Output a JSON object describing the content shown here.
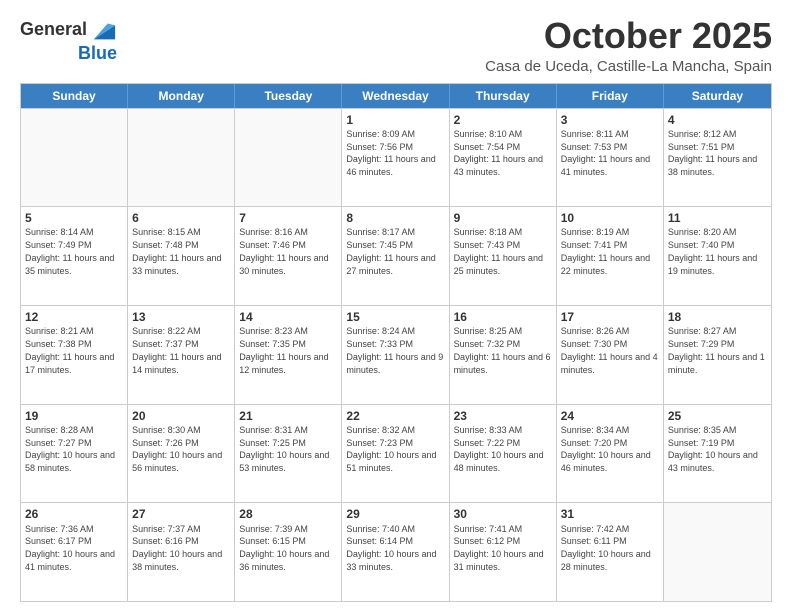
{
  "header": {
    "logo_general": "General",
    "logo_blue": "Blue",
    "month": "October 2025",
    "location": "Casa de Uceda, Castille-La Mancha, Spain"
  },
  "days_of_week": [
    "Sunday",
    "Monday",
    "Tuesday",
    "Wednesday",
    "Thursday",
    "Friday",
    "Saturday"
  ],
  "weeks": [
    [
      {
        "day": "",
        "info": ""
      },
      {
        "day": "",
        "info": ""
      },
      {
        "day": "",
        "info": ""
      },
      {
        "day": "1",
        "info": "Sunrise: 8:09 AM\nSunset: 7:56 PM\nDaylight: 11 hours and 46 minutes."
      },
      {
        "day": "2",
        "info": "Sunrise: 8:10 AM\nSunset: 7:54 PM\nDaylight: 11 hours and 43 minutes."
      },
      {
        "day": "3",
        "info": "Sunrise: 8:11 AM\nSunset: 7:53 PM\nDaylight: 11 hours and 41 minutes."
      },
      {
        "day": "4",
        "info": "Sunrise: 8:12 AM\nSunset: 7:51 PM\nDaylight: 11 hours and 38 minutes."
      }
    ],
    [
      {
        "day": "5",
        "info": "Sunrise: 8:14 AM\nSunset: 7:49 PM\nDaylight: 11 hours and 35 minutes."
      },
      {
        "day": "6",
        "info": "Sunrise: 8:15 AM\nSunset: 7:48 PM\nDaylight: 11 hours and 33 minutes."
      },
      {
        "day": "7",
        "info": "Sunrise: 8:16 AM\nSunset: 7:46 PM\nDaylight: 11 hours and 30 minutes."
      },
      {
        "day": "8",
        "info": "Sunrise: 8:17 AM\nSunset: 7:45 PM\nDaylight: 11 hours and 27 minutes."
      },
      {
        "day": "9",
        "info": "Sunrise: 8:18 AM\nSunset: 7:43 PM\nDaylight: 11 hours and 25 minutes."
      },
      {
        "day": "10",
        "info": "Sunrise: 8:19 AM\nSunset: 7:41 PM\nDaylight: 11 hours and 22 minutes."
      },
      {
        "day": "11",
        "info": "Sunrise: 8:20 AM\nSunset: 7:40 PM\nDaylight: 11 hours and 19 minutes."
      }
    ],
    [
      {
        "day": "12",
        "info": "Sunrise: 8:21 AM\nSunset: 7:38 PM\nDaylight: 11 hours and 17 minutes."
      },
      {
        "day": "13",
        "info": "Sunrise: 8:22 AM\nSunset: 7:37 PM\nDaylight: 11 hours and 14 minutes."
      },
      {
        "day": "14",
        "info": "Sunrise: 8:23 AM\nSunset: 7:35 PM\nDaylight: 11 hours and 12 minutes."
      },
      {
        "day": "15",
        "info": "Sunrise: 8:24 AM\nSunset: 7:33 PM\nDaylight: 11 hours and 9 minutes."
      },
      {
        "day": "16",
        "info": "Sunrise: 8:25 AM\nSunset: 7:32 PM\nDaylight: 11 hours and 6 minutes."
      },
      {
        "day": "17",
        "info": "Sunrise: 8:26 AM\nSunset: 7:30 PM\nDaylight: 11 hours and 4 minutes."
      },
      {
        "day": "18",
        "info": "Sunrise: 8:27 AM\nSunset: 7:29 PM\nDaylight: 11 hours and 1 minute."
      }
    ],
    [
      {
        "day": "19",
        "info": "Sunrise: 8:28 AM\nSunset: 7:27 PM\nDaylight: 10 hours and 58 minutes."
      },
      {
        "day": "20",
        "info": "Sunrise: 8:30 AM\nSunset: 7:26 PM\nDaylight: 10 hours and 56 minutes."
      },
      {
        "day": "21",
        "info": "Sunrise: 8:31 AM\nSunset: 7:25 PM\nDaylight: 10 hours and 53 minutes."
      },
      {
        "day": "22",
        "info": "Sunrise: 8:32 AM\nSunset: 7:23 PM\nDaylight: 10 hours and 51 minutes."
      },
      {
        "day": "23",
        "info": "Sunrise: 8:33 AM\nSunset: 7:22 PM\nDaylight: 10 hours and 48 minutes."
      },
      {
        "day": "24",
        "info": "Sunrise: 8:34 AM\nSunset: 7:20 PM\nDaylight: 10 hours and 46 minutes."
      },
      {
        "day": "25",
        "info": "Sunrise: 8:35 AM\nSunset: 7:19 PM\nDaylight: 10 hours and 43 minutes."
      }
    ],
    [
      {
        "day": "26",
        "info": "Sunrise: 7:36 AM\nSunset: 6:17 PM\nDaylight: 10 hours and 41 minutes."
      },
      {
        "day": "27",
        "info": "Sunrise: 7:37 AM\nSunset: 6:16 PM\nDaylight: 10 hours and 38 minutes."
      },
      {
        "day": "28",
        "info": "Sunrise: 7:39 AM\nSunset: 6:15 PM\nDaylight: 10 hours and 36 minutes."
      },
      {
        "day": "29",
        "info": "Sunrise: 7:40 AM\nSunset: 6:14 PM\nDaylight: 10 hours and 33 minutes."
      },
      {
        "day": "30",
        "info": "Sunrise: 7:41 AM\nSunset: 6:12 PM\nDaylight: 10 hours and 31 minutes."
      },
      {
        "day": "31",
        "info": "Sunrise: 7:42 AM\nSunset: 6:11 PM\nDaylight: 10 hours and 28 minutes."
      },
      {
        "day": "",
        "info": ""
      }
    ]
  ]
}
